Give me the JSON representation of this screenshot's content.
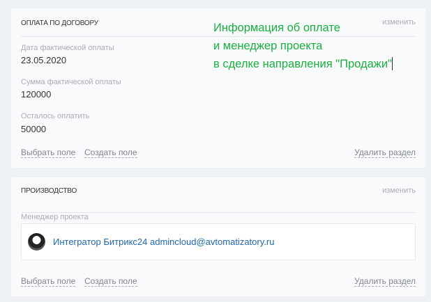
{
  "annotation": {
    "lines": [
      "Информация об оплате",
      "и менеджер проекта",
      "в сделке направления \"Продажи\""
    ]
  },
  "sections": [
    {
      "title": "ОПЛАТА ПО ДОГОВОРУ",
      "edit": "изменить",
      "fields": [
        {
          "label": "Дата фактической оплаты",
          "value": "23.05.2020"
        },
        {
          "label": "Сумма фактической оплаты",
          "value": "120000"
        },
        {
          "label": "Осталось оплатить",
          "value": "50000"
        }
      ],
      "select_field": "Выбрать поле",
      "create_field": "Создать поле",
      "delete_section": "Удалить раздел"
    },
    {
      "title": "ПРОИЗВОДСТВО",
      "edit": "изменить",
      "fields": [
        {
          "label": "Менеджер проекта",
          "value": "Интегратор Битрикс24 admincloud@avtomatizatory.ru"
        }
      ],
      "select_field": "Выбрать поле",
      "create_field": "Создать поле",
      "delete_section": "Удалить раздел"
    }
  ]
}
